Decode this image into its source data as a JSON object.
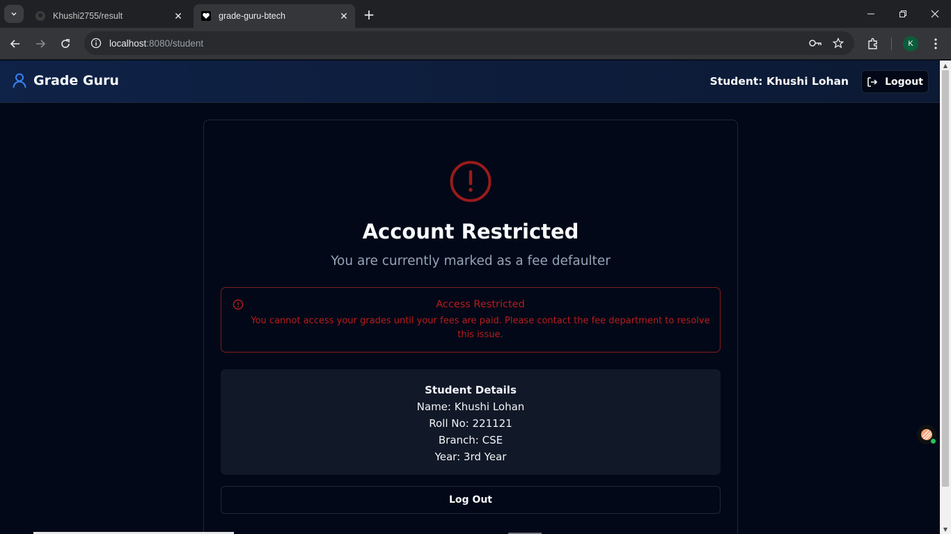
{
  "browser": {
    "tabs": [
      {
        "title": "Khushi2755/result",
        "favicon": "github-icon",
        "active": false
      },
      {
        "title": "grade-guru-btech",
        "favicon": "heart-icon",
        "active": true
      }
    ],
    "url_host": "localhost",
    "url_rest": ":8080/student",
    "profile_initial": "K"
  },
  "app": {
    "brand": "Grade Guru",
    "brand_icon": "user-icon",
    "student_label": "Student: Khushi Lohan",
    "logout_label": "Logout"
  },
  "card": {
    "title": "Account Restricted",
    "subtitle": "You are currently marked as a fee defaulter",
    "alert": {
      "title": "Access Restricted",
      "message": "You cannot access your grades until your fees are paid. Please contact the fee department to resolve this issue."
    },
    "details": {
      "heading": "Student Details",
      "name": "Name: Khushi Lohan",
      "roll": "Roll No: 221121",
      "branch": "Branch: CSE",
      "year": "Year: 3rd Year"
    },
    "logout_button": "Log Out"
  },
  "colors": {
    "accent_blue": "#3b82f6",
    "danger": "#b91c1c",
    "background": "#020817"
  }
}
